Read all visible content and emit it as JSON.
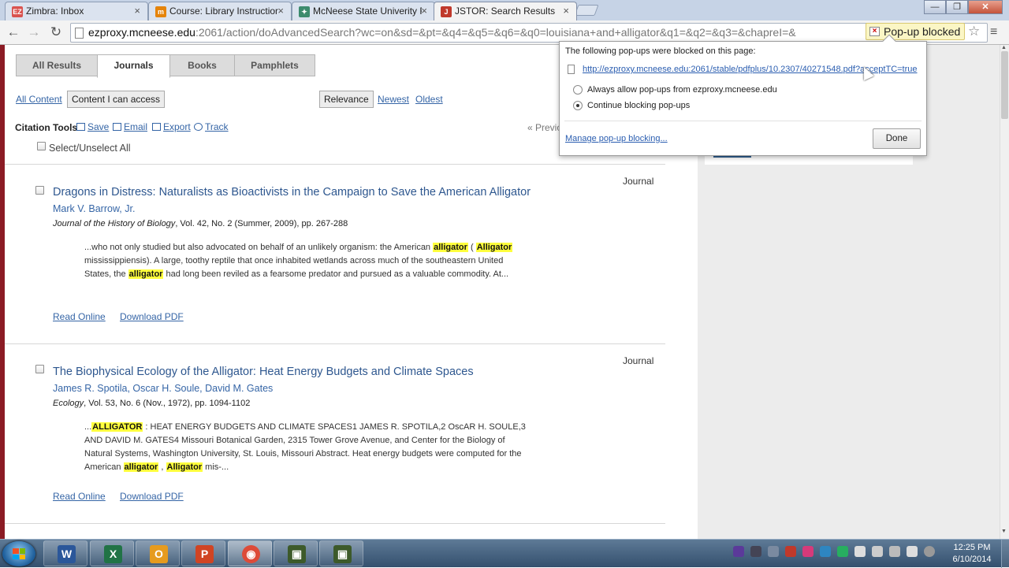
{
  "browser": {
    "tabs": [
      {
        "title": "Zimbra: Inbox",
        "icon": "zimbra-icon",
        "icon_text": "EZ",
        "icon_color": "#d9534f",
        "active": false
      },
      {
        "title": "Course: Library Instruction",
        "icon": "moodle-icon",
        "icon_text": "m",
        "icon_color": "#e5840b",
        "active": false
      },
      {
        "title": "McNeese State Univerity F",
        "icon": "mcneese-icon",
        "icon_text": "✦",
        "icon_color": "#3c8b6d",
        "active": false
      },
      {
        "title": "JSTOR: Search Results",
        "icon": "jstor-icon",
        "icon_text": "J",
        "icon_color": "#c0392b",
        "active": true
      }
    ],
    "tab_close_glyph": "×",
    "window_controls": {
      "minimize": "—",
      "restore": "❐",
      "close": "✕"
    },
    "back_glyph": "←",
    "forward_glyph": "→",
    "reload_glyph": "↻",
    "url_host": "ezproxy.mcneese.edu",
    "url_rest": ":2061/action/doAdvancedSearch?wc=on&sd=&pt=&q4=&q5=&q6=&q0=louisiana+and+alligator&q1=&q2=&q3=&chapreI=&",
    "popup_blocked_label": "Pop-up blocked",
    "star_glyph": "☆",
    "menu_glyph": "≡"
  },
  "popup_bubble": {
    "heading": "The following pop-ups were blocked on this page:",
    "blocked_url": "http://ezproxy.mcneese.edu:2061/stable/pdfplus/10.2307/40271548.pdf?acceptTC=true",
    "option_allow": "Always allow pop-ups from ezproxy.mcneese.edu",
    "option_block": "Continue blocking pop-ups",
    "selected_option": "block",
    "manage_link": "Manage pop-up blocking...",
    "done_button": "Done"
  },
  "search": {
    "tabs": [
      "All Results",
      "Journals",
      "Books",
      "Pamphlets"
    ],
    "active_tab": "Journals",
    "filters": {
      "all_content": "All Content",
      "content_access": "Content I can access"
    },
    "sort": {
      "relevance": "Relevance",
      "newest": "Newest",
      "oldest": "Oldest"
    },
    "citation_tools": {
      "label": "Citation Tools",
      "save": "Save",
      "email": "Email",
      "export": "Export",
      "track": "Track"
    },
    "pager_prev": "« Previo",
    "select_all": "Select/Unselect All"
  },
  "results": [
    {
      "type": "Journal",
      "title": "Dragons in Distress: Naturalists as Bioactivists in the Campaign to Save the American Alligator",
      "authors": "Mark V. Barrow, Jr.",
      "journal": "Journal of the History of Biology",
      "citation_rest": ", Vol. 42, No. 2 (Summer, 2009), pp. 267-288",
      "read_online": "Read Online",
      "download_pdf": "Download PDF"
    },
    {
      "type": "Journal",
      "title": "The Biophysical Ecology of the Alligator: Heat Energy Budgets and Climate Spaces",
      "authors": "James R. Spotila, Oscar H. Soule, David M. Gates",
      "journal": "Ecology",
      "citation_rest": ", Vol. 53, No. 6 (Nov., 1972), pp. 1094-1102",
      "read_online": "Read Online",
      "download_pdf": "Download PDF"
    }
  ],
  "snippet1": {
    "a": "...who not only studied but also advocated on behalf of an unlikely organism: the American ",
    "h1": "alligator",
    "b": " ( ",
    "h2": "Alligator",
    "c": " mississippiensis). A large, toothy reptile that once inhabited wetlands across much of the southeastern United States, the ",
    "h3": "alligator",
    "d": " had long been reviled as a fearsome predator and pursued as a valuable commodity. At..."
  },
  "snippet2": {
    "a": "...",
    "h1": "ALLIGATOR",
    "b": " : HEAT ENERGY BUDGETS AND CLIMATE SPACES1 JAMES R. SPOTILA,2 OscAR H. SOULE,3 AND DAVID M. GATES4 Missouri Botanical Garden, 2315 Tower Grove Avenue, and Center for the Biology of Natural Systems, Washington University, St. Louis, Missouri Abstract. Heat energy budgets were computed for the American ",
    "h2": "alligator",
    "c": " , ",
    "h3": "Alligator",
    "d": " mis-..."
  },
  "taskbar": {
    "apps": [
      {
        "name": "word-app",
        "glyph": "W",
        "color": "#2b579a"
      },
      {
        "name": "excel-app",
        "glyph": "X",
        "color": "#217346"
      },
      {
        "name": "outlook-app",
        "glyph": "O",
        "color": "#e69b1e"
      },
      {
        "name": "powerpoint-app",
        "glyph": "P",
        "color": "#d04423"
      },
      {
        "name": "chrome-app",
        "glyph": "◉",
        "color": "#dd4b39"
      },
      {
        "name": "camtasia-app",
        "glyph": "▣",
        "color": "#3d5a2a"
      },
      {
        "name": "recorder-app",
        "glyph": "▣",
        "color": "#3d5a2a"
      }
    ],
    "clock_time": "12:25 PM",
    "clock_date": "6/10/2014",
    "accent": "#34506e"
  }
}
